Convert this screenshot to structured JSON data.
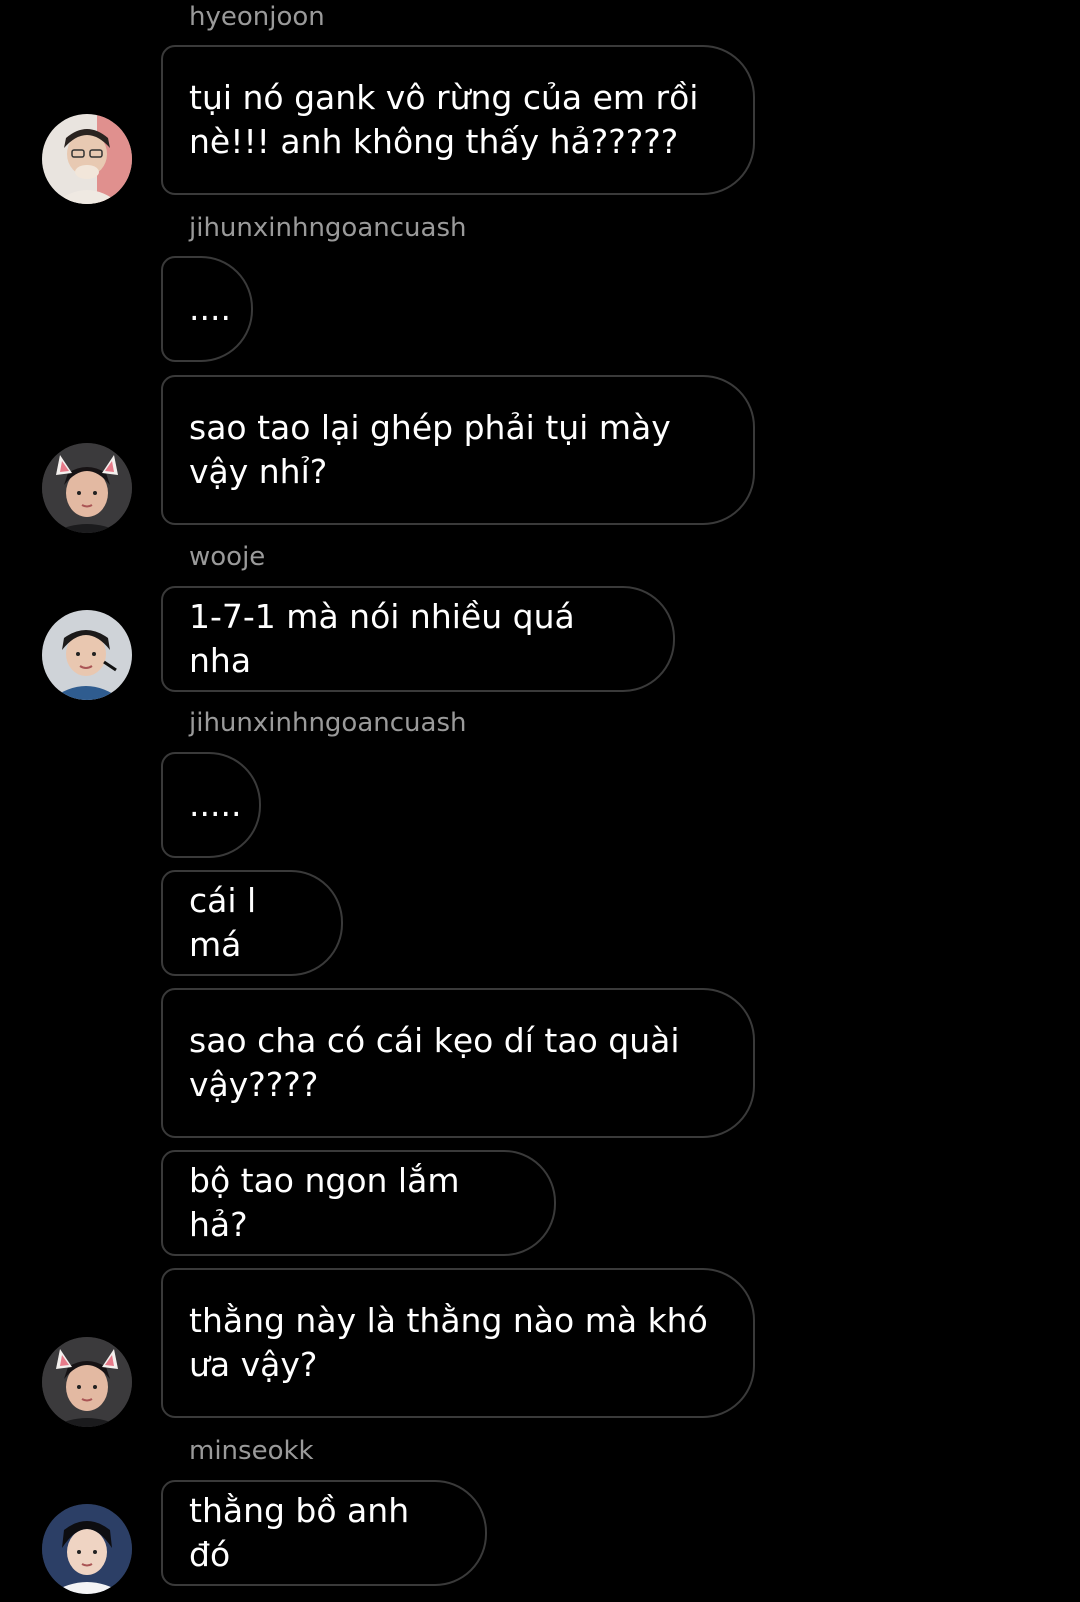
{
  "messages": {
    "sender_hyeonjoon": "hyeonjoon",
    "msg_1": "tụi nó gank vô rừng của em rồi\nnè!!! anh không thấy hả?????",
    "sender_jihun_1": "jihunxinhngoancuash",
    "msg_2": "....",
    "msg_3": "sao tao lại ghép phải tụi mày\nvậy nhỉ?",
    "sender_wooje": "wooje",
    "msg_4": "1-7-1 mà nói nhiều quá nha",
    "sender_jihun_2": "jihunxinhngoancuash",
    "msg_5": ".....",
    "msg_6": "cái l má",
    "msg_7": "sao cha có cái kẹo dí tao quài\nvậy????",
    "msg_8": "bộ tao ngon lắm hả?",
    "msg_9": "thằng này là thằng nào mà khó\nưa vậy?",
    "sender_minseokk": "minseokk",
    "msg_10": "thằng bồ anh đó"
  },
  "colors": {
    "background": "#000000",
    "bubble_border": "#3a3a3a",
    "sender_text": "#9a9a9a",
    "message_text": "#ffffff"
  }
}
